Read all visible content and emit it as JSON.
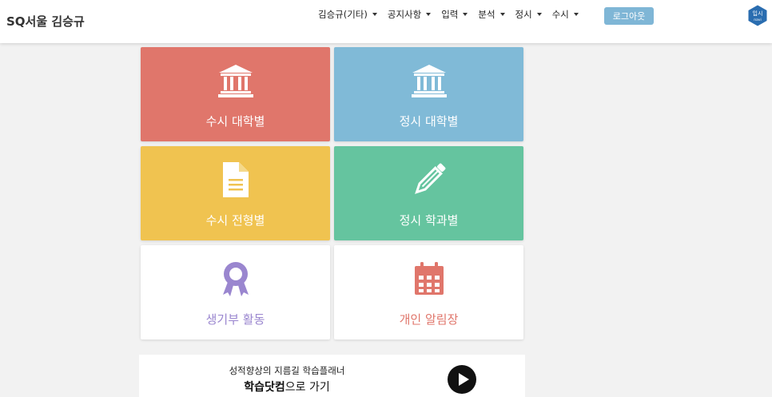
{
  "header": {
    "brand": "SQ서울 김승규",
    "menu": [
      {
        "label": "김승규(기타)"
      },
      {
        "label": "공지사항"
      },
      {
        "label": "입력"
      },
      {
        "label": "분석"
      },
      {
        "label": "정시"
      },
      {
        "label": "수시"
      }
    ],
    "logout_label": "로그아웃",
    "logo_text": [
      "입시",
      "navi"
    ]
  },
  "tiles": [
    {
      "label": "수시 대학별",
      "icon": "university-icon",
      "color": "#e0766b"
    },
    {
      "label": "정시 대학별",
      "icon": "university-icon",
      "color": "#80bad7"
    },
    {
      "label": "수시 전형별",
      "icon": "document-icon",
      "color": "#f0c350"
    },
    {
      "label": "정시 학과별",
      "icon": "pencil-icon",
      "color": "#65c49f"
    },
    {
      "label": "생기부 활동",
      "icon": "award-icon",
      "color": "#9a86cf"
    },
    {
      "label": "개인 알림장",
      "icon": "calendar-icon",
      "color": "#e0766b"
    }
  ],
  "banner": {
    "subtitle": "성적향상의 지름길 학습플래너",
    "title_bold": "학습닷컴",
    "title_rest": "으로 가기",
    "icon": "play-icon"
  }
}
